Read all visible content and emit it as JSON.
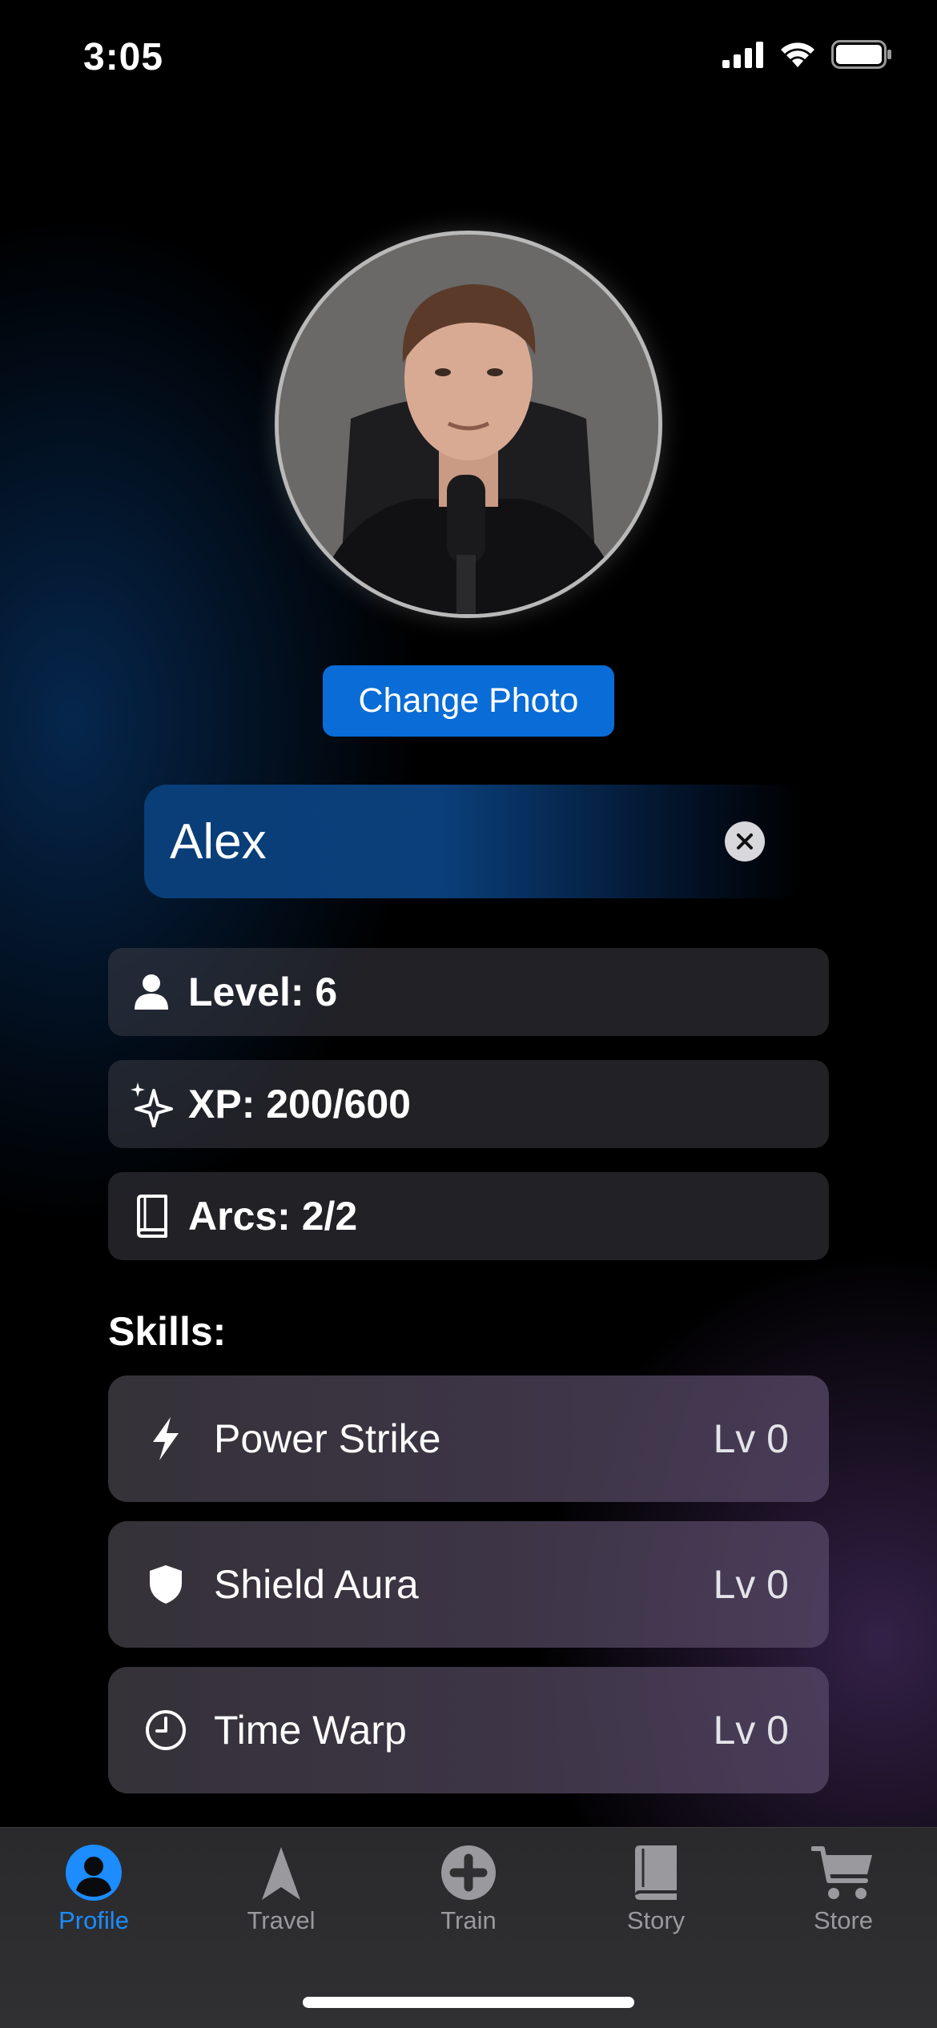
{
  "status_bar": {
    "time": "3:05"
  },
  "profile": {
    "change_photo_label": "Change Photo",
    "name_value": "Alex"
  },
  "stats": [
    {
      "icon": "person-icon",
      "label": "Level: 6"
    },
    {
      "icon": "sparkles-icon",
      "label": "XP: 200/600"
    },
    {
      "icon": "book-icon",
      "label": "Arcs: 2/2"
    }
  ],
  "skills_title": "Skills:",
  "skills": [
    {
      "icon": "bolt-icon",
      "name": "Power Strike",
      "level": "Lv 0"
    },
    {
      "icon": "shield-icon",
      "name": "Shield Aura",
      "level": "Lv 0"
    },
    {
      "icon": "clock-icon",
      "name": "Time Warp",
      "level": "Lv 0"
    }
  ],
  "tabs": [
    {
      "icon": "profile-icon",
      "label": "Profile",
      "active": true
    },
    {
      "icon": "navigation-arrow-icon",
      "label": "Travel",
      "active": false
    },
    {
      "icon": "plus-circle-icon",
      "label": "Train",
      "active": false
    },
    {
      "icon": "book-icon",
      "label": "Story",
      "active": false
    },
    {
      "icon": "cart-icon",
      "label": "Store",
      "active": false
    }
  ],
  "colors": {
    "accent": "#0a6cd6",
    "tab_active": "#1c8cff",
    "tab_inactive": "#9a9a9e"
  }
}
